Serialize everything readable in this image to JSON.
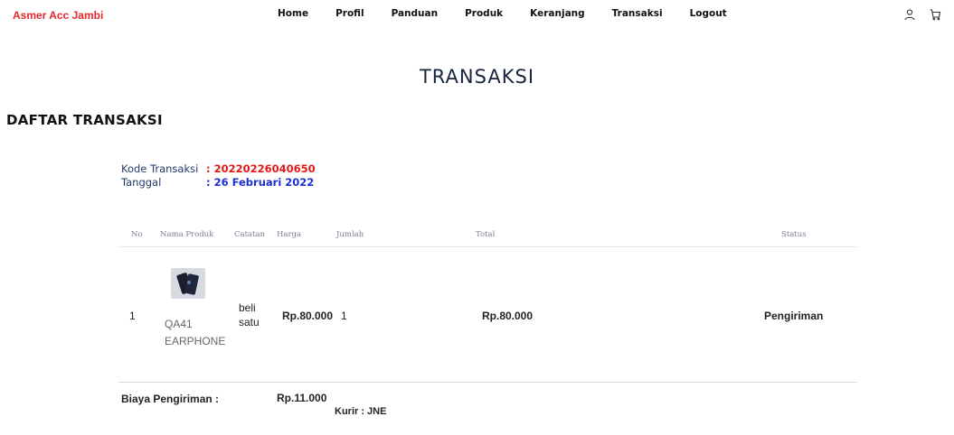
{
  "header": {
    "brand": "Asmer Acc Jambi",
    "nav": [
      "Home",
      "Profil",
      "Panduan",
      "Produk",
      "Keranjang",
      "Transaksi",
      "Logout"
    ],
    "icons": [
      "user-icon",
      "cart-icon"
    ]
  },
  "page": {
    "title": "TRANSAKSI",
    "section_title": "DAFTAR TRANSAKSI"
  },
  "transaction": {
    "kode_label": "Kode Transaksi",
    "kode_value": ": 20220226040650",
    "tanggal_label": "Tanggal",
    "tanggal_value": ": 26 Februari 2022"
  },
  "table": {
    "headers": [
      "No",
      "Nama Produk",
      "Catatan",
      "Harga",
      "Jumlah",
      "Total",
      "Status"
    ],
    "rows": [
      {
        "no": "1",
        "nama_produk_line1": "QA41",
        "nama_produk_line2": "EARPHONE",
        "catatan": "beli satu",
        "harga": "Rp.80.000",
        "jumlah": "1",
        "total": "Rp.80.000",
        "status": "Pengiriman"
      }
    ]
  },
  "shipping": {
    "label": "Biaya Pengiriman :",
    "value": "Rp.11.000",
    "kurir": "Kurir : JNE"
  },
  "colors": {
    "brand": "#e8252b",
    "title": "#18253f",
    "kode": "#e11818",
    "tanggal": "#1a2fd6"
  }
}
